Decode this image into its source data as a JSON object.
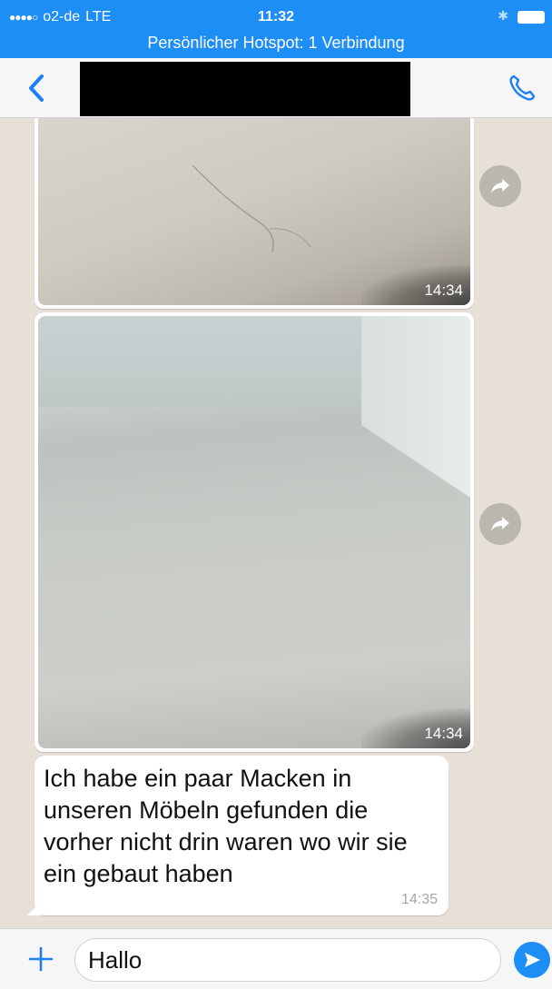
{
  "status_bar": {
    "signal_dots": "●●●●○",
    "carrier": "o2-de",
    "network": "LTE",
    "time": "11:32",
    "hotspot_text": "Persönlicher Hotspot: 1 Verbindung",
    "bluetooth_icon": "bluetooth-icon",
    "battery_icon": "battery-icon"
  },
  "nav": {
    "back_icon": "chevron-left-icon",
    "call_icon": "phone-icon"
  },
  "messages": [
    {
      "type": "image",
      "time": "14:34"
    },
    {
      "type": "image",
      "time": "14:34"
    },
    {
      "type": "text",
      "text": "Ich habe ein paar Macken in unseren Möbeln gefunden die vorher nicht drin waren wo wir sie ein gebaut haben",
      "time": "14:35"
    }
  ],
  "input": {
    "value": "Hallo"
  },
  "colors": {
    "accent": "#1d8ef5",
    "chat_background": "#e7e0d6",
    "bubble": "#ffffff"
  }
}
